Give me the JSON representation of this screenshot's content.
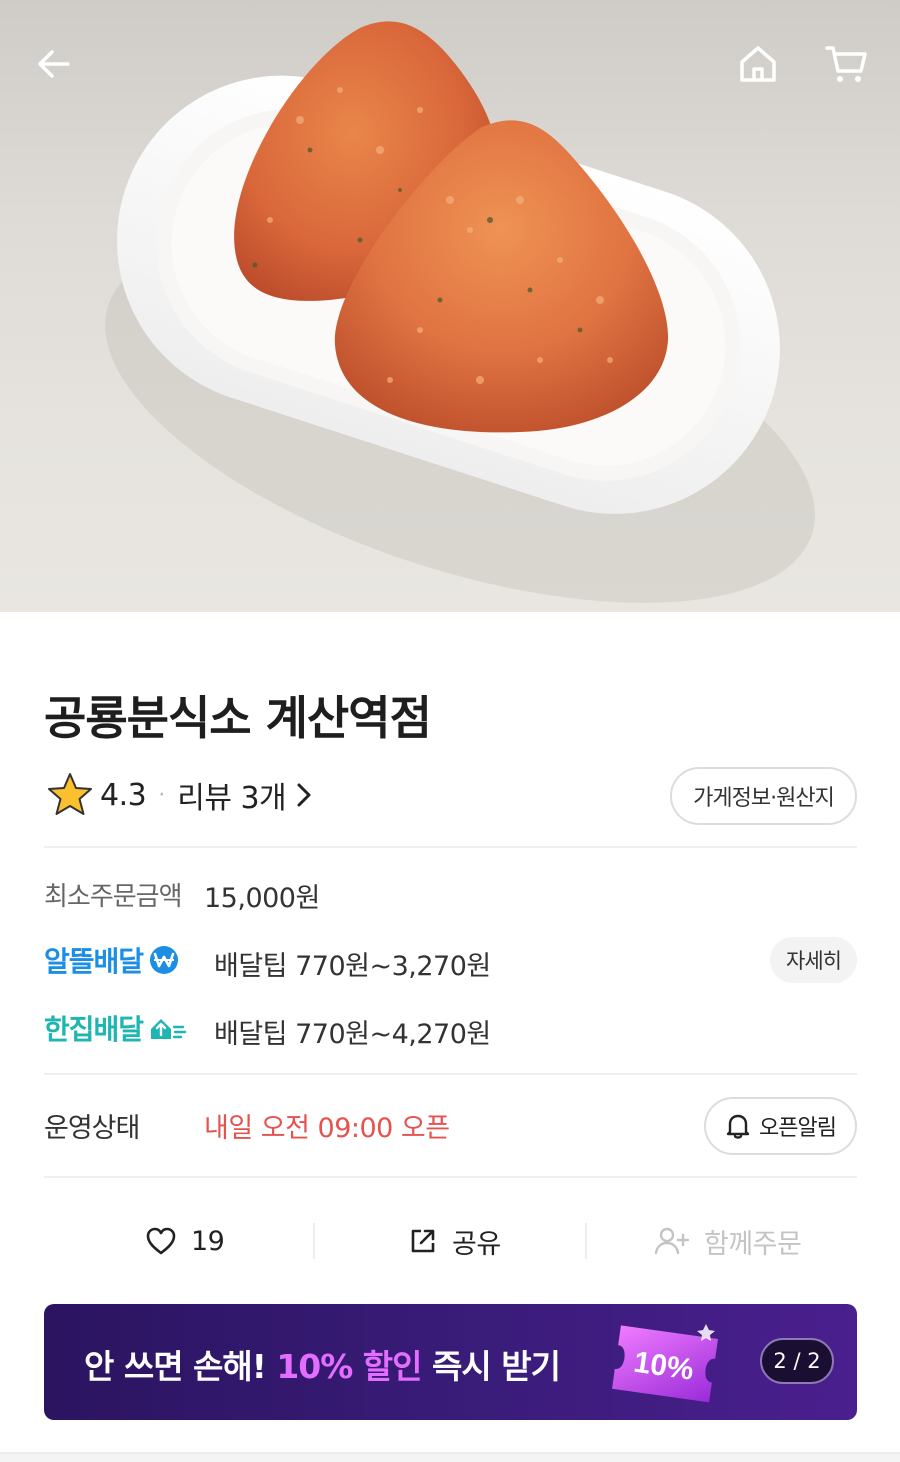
{
  "header": {
    "back_icon": "back-arrow-icon",
    "home_icon": "home-icon",
    "cart_icon": "cart-icon"
  },
  "hero": {
    "image_subject": "two triangular seasoned rice balls in a white oval dish"
  },
  "store": {
    "name": "공룡분식소 계산역점",
    "rating": "4.3",
    "rating_separator": "·",
    "review_label": "리뷰 3개",
    "info_button": "가게정보·원산지"
  },
  "order": {
    "min_label": "최소주문금액",
    "min_value": "15,000원"
  },
  "delivery": {
    "saver": {
      "brand": "알뜰배달",
      "tip": "배달팁 770원~3,270원",
      "brand_color": "#1c8ee4"
    },
    "single": {
      "brand": "한집배달",
      "tip": "배달팁 770원~4,270원",
      "brand_color": "#1fb5b0"
    },
    "detail_button": "자세히"
  },
  "status": {
    "label": "운영상태",
    "value": "내일 오전 09:00 오픈",
    "value_color": "#e4534f",
    "alarm_button": "오픈알림"
  },
  "actions": {
    "like_count": "19",
    "share_label": "공유",
    "group_order_label": "함께주문"
  },
  "banner": {
    "text_pre": "안 쓰면 손해! ",
    "text_highlight": "10% 할인",
    "text_post": " 즉시 받기",
    "coupon_text": "10%",
    "page_indicator": "2 / 2"
  }
}
